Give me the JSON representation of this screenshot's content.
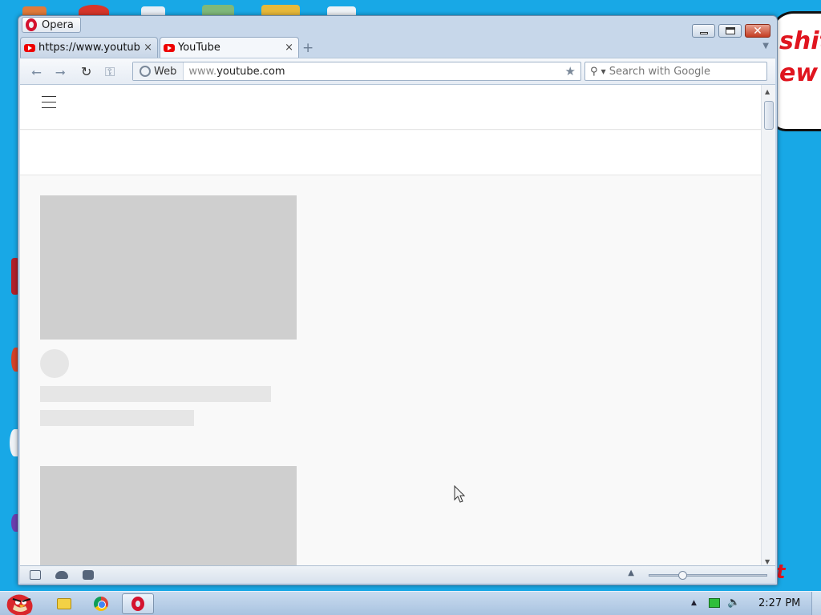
{
  "browser": {
    "app_button_label": "Opera",
    "tabs": [
      {
        "title": "https://www.youtube...."
      },
      {
        "title": "YouTube"
      }
    ],
    "tab_close_glyph": "×",
    "new_tab_glyph": "+",
    "tab_menu_glyph": "▼",
    "address": {
      "security_label": "Web",
      "url_prefix": "www.",
      "url_domain": "youtube.com"
    },
    "search": {
      "placeholder": "Search with Google"
    }
  },
  "desktop": {
    "comic_lines": [
      "shit",
      "ew"
    ],
    "comic_bottom_glyph": "t"
  },
  "taskbar": {
    "clock": "2:27 PM"
  },
  "icons": {
    "back": "arrow-left-icon",
    "forward": "arrow-right-icon",
    "reload": "reload-icon",
    "key": "key-icon",
    "star": "star-icon",
    "search": "search-icon"
  },
  "colors": {
    "desktop_bg": "#18a8e6",
    "youtube_red": "#ee0000",
    "opera_red": "#d4122e",
    "placeholder_gray": "#cfcfcf"
  }
}
